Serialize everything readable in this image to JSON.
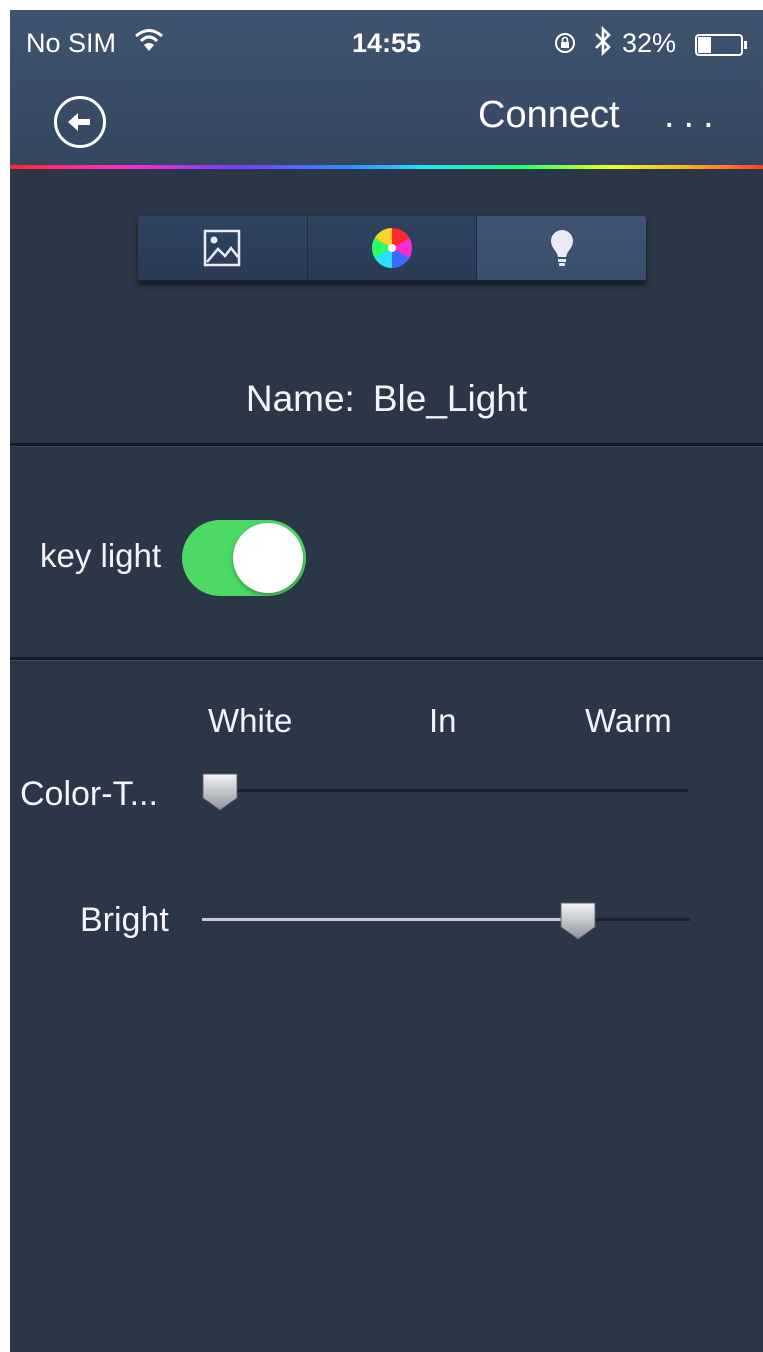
{
  "status_bar": {
    "carrier": "No SIM",
    "time": "14:55",
    "battery": "32%",
    "battery_level": 0.32,
    "icons": [
      "wifi-icon",
      "rotation-lock-icon",
      "bluetooth-icon",
      "battery-icon"
    ]
  },
  "nav": {
    "back_icon": "back-arrow-icon",
    "connect_label": "Connect",
    "more_label": "...",
    "rainbow_accent": [
      "#ff2a2a",
      "#ff2ad0",
      "#7a3cff",
      "#2a8cff",
      "#2ae0ff",
      "#2aff6a",
      "#e8ff2a",
      "#ffb02a"
    ]
  },
  "segments": [
    {
      "icon": "picture-icon",
      "selected": false
    },
    {
      "icon": "color-wheel-icon",
      "selected": false
    },
    {
      "icon": "light-bulb-icon",
      "selected": true
    }
  ],
  "device": {
    "name_label": "Name:",
    "name_value": "Ble_Light"
  },
  "key_light": {
    "label": "key light",
    "on": true
  },
  "color_temp": {
    "scale_labels": [
      "White",
      "In",
      "Warm"
    ],
    "label": "Color-T...",
    "value": 0.02
  },
  "bright": {
    "label": "Bright",
    "value": 0.77
  },
  "colors": {
    "background": "#2b3646",
    "nav_background": "#3a4c67",
    "toggle_on": "#4cd964",
    "text": "#f2f4f7"
  }
}
